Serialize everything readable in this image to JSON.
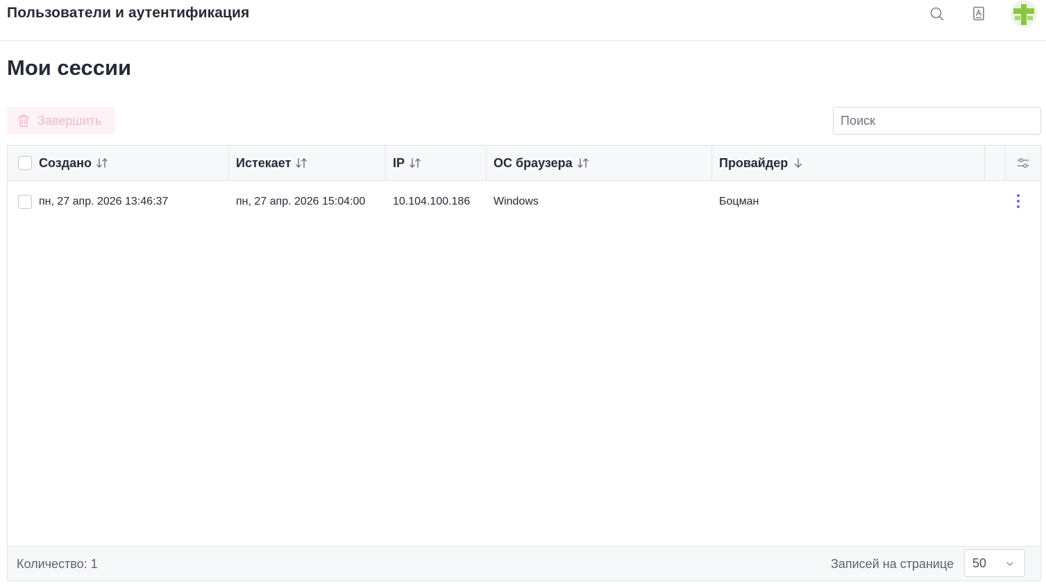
{
  "header": {
    "app_title": "Пользователи и аутентификация",
    "icons": [
      "search-icon",
      "document-icon"
    ]
  },
  "page": {
    "title": "Мои сессии"
  },
  "toolbar": {
    "end_button_label": "Завершить",
    "end_button_state": "disabled",
    "search_placeholder": "Поиск",
    "search_value": ""
  },
  "table": {
    "columns": [
      {
        "label": "Создано",
        "sort": "unsorted"
      },
      {
        "label": "Истекает",
        "sort": "unsorted"
      },
      {
        "label": "IP",
        "sort": "unsorted"
      },
      {
        "label": "ОС браузера",
        "sort": "unsorted"
      },
      {
        "label": "Провайдер",
        "sort": "descending"
      }
    ],
    "rows": [
      {
        "created": "пн, 27 апр. 2026 13:46:37",
        "expires": "пн, 27 апр. 2026 15:04:00",
        "ip": "10.104.100.186",
        "browser_os": "Windows",
        "provider": "Боцман",
        "selected": false
      }
    ]
  },
  "footer": {
    "count_text": "Количество: 1",
    "per_page_label": "Записей на странице",
    "per_page_value": "50"
  },
  "colors": {
    "accent": "#7c5cd6",
    "danger_disabled_text": "#f4b8c8",
    "danger_disabled_bg": "#fdf3f6",
    "logo_green": "#8bc63f"
  }
}
